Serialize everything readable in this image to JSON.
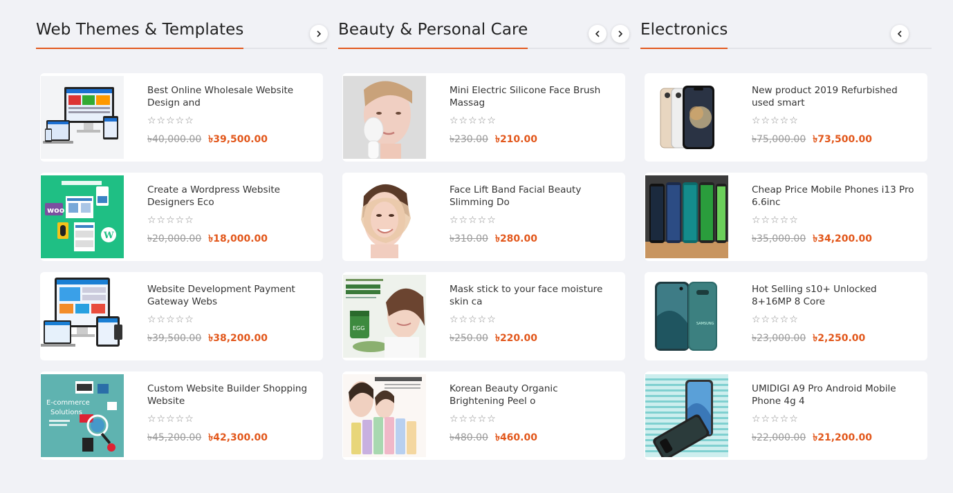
{
  "columns": [
    {
      "title": "Web Themes & Templates",
      "products": [
        {
          "name": "Best Online Wholesale Website Design and",
          "old_price": "৳40,000.00",
          "new_price": "৳39,500.00",
          "stars": "☆☆☆☆☆"
        },
        {
          "name": "Create a Wordpress Website Designers Eco",
          "old_price": "৳20,000.00",
          "new_price": "৳18,000.00",
          "stars": "☆☆☆☆☆"
        },
        {
          "name": "Website Development Payment Gateway Webs",
          "old_price": "৳39,500.00",
          "new_price": "৳38,200.00",
          "stars": "☆☆☆☆☆"
        },
        {
          "name": "Custom Website Builder Shopping Website",
          "old_price": "৳45,200.00",
          "new_price": "৳42,300.00",
          "stars": "☆☆☆☆☆"
        }
      ]
    },
    {
      "title": "Beauty & Personal Care",
      "products": [
        {
          "name": "Mini Electric Silicone Face Brush Massag",
          "old_price": "৳230.00",
          "new_price": "৳210.00",
          "stars": "☆☆☆☆☆"
        },
        {
          "name": "Face Lift Band Facial Beauty Slimming Do",
          "old_price": "৳310.00",
          "new_price": "৳280.00",
          "stars": "☆☆☆☆☆"
        },
        {
          "name": "Mask stick to your face moisture skin ca",
          "old_price": "৳250.00",
          "new_price": "৳220.00",
          "stars": "☆☆☆☆☆"
        },
        {
          "name": "Korean Beauty Organic Brightening Peel o",
          "old_price": "৳480.00",
          "new_price": "৳460.00",
          "stars": "☆☆☆☆☆"
        }
      ]
    },
    {
      "title": "Electronics",
      "products": [
        {
          "name": "New product 2019 Refurbished used smart",
          "old_price": "৳75,000.00",
          "new_price": "৳73,500.00",
          "stars": "☆☆☆☆☆"
        },
        {
          "name": "Cheap Price Mobile Phones i13 Pro 6.6inc",
          "old_price": "৳35,000.00",
          "new_price": "৳34,200.00",
          "stars": "☆☆☆☆☆"
        },
        {
          "name": "Hot Selling s10+ Unlocked 8+16MP 8 Core",
          "old_price": "৳23,000.00",
          "new_price": "৳2,250.00",
          "stars": "☆☆☆☆☆"
        },
        {
          "name": "UMIDIGI A9 Pro Android Mobile Phone 4g 4",
          "old_price": "৳22,000.00",
          "new_price": "৳21,200.00",
          "stars": "☆☆☆☆☆"
        }
      ]
    }
  ],
  "colors": {
    "accent": "#e2571b",
    "background": "#f1f2f6",
    "card": "#ffffff"
  },
  "icons": {
    "prev": "chevron-left-icon",
    "next": "chevron-right-icon",
    "star": "star-outline-icon"
  }
}
